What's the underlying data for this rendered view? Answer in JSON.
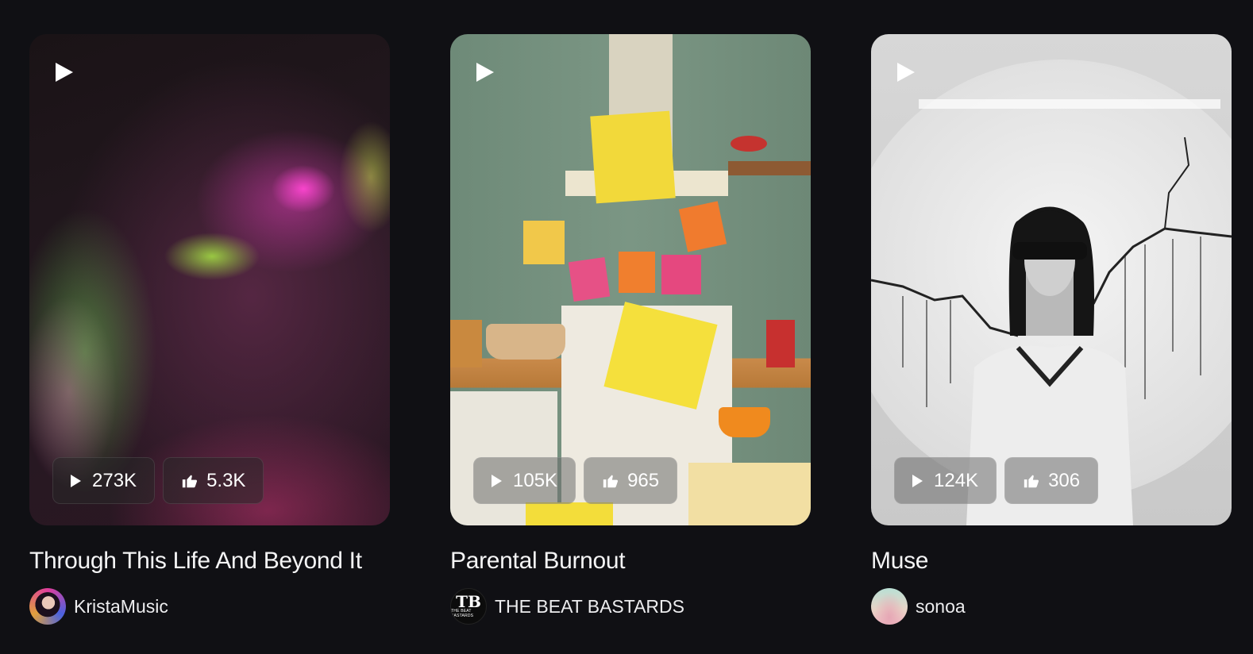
{
  "cards": [
    {
      "title": "Through This Life And Beyond It",
      "author": "KristaMusic",
      "plays": "273K",
      "likes": "5.3K"
    },
    {
      "title": "Parental Burnout",
      "author": "THE BEAT BASTARDS",
      "avatar_text": "TB",
      "avatar_subtext": "THE BEAT BASTARDS",
      "plays": "105K",
      "likes": "965"
    },
    {
      "title": "Muse",
      "author": "sonoa",
      "plays": "124K",
      "likes": "306"
    }
  ],
  "icons": {
    "play": "play-icon",
    "like": "thumbs-up-icon"
  }
}
